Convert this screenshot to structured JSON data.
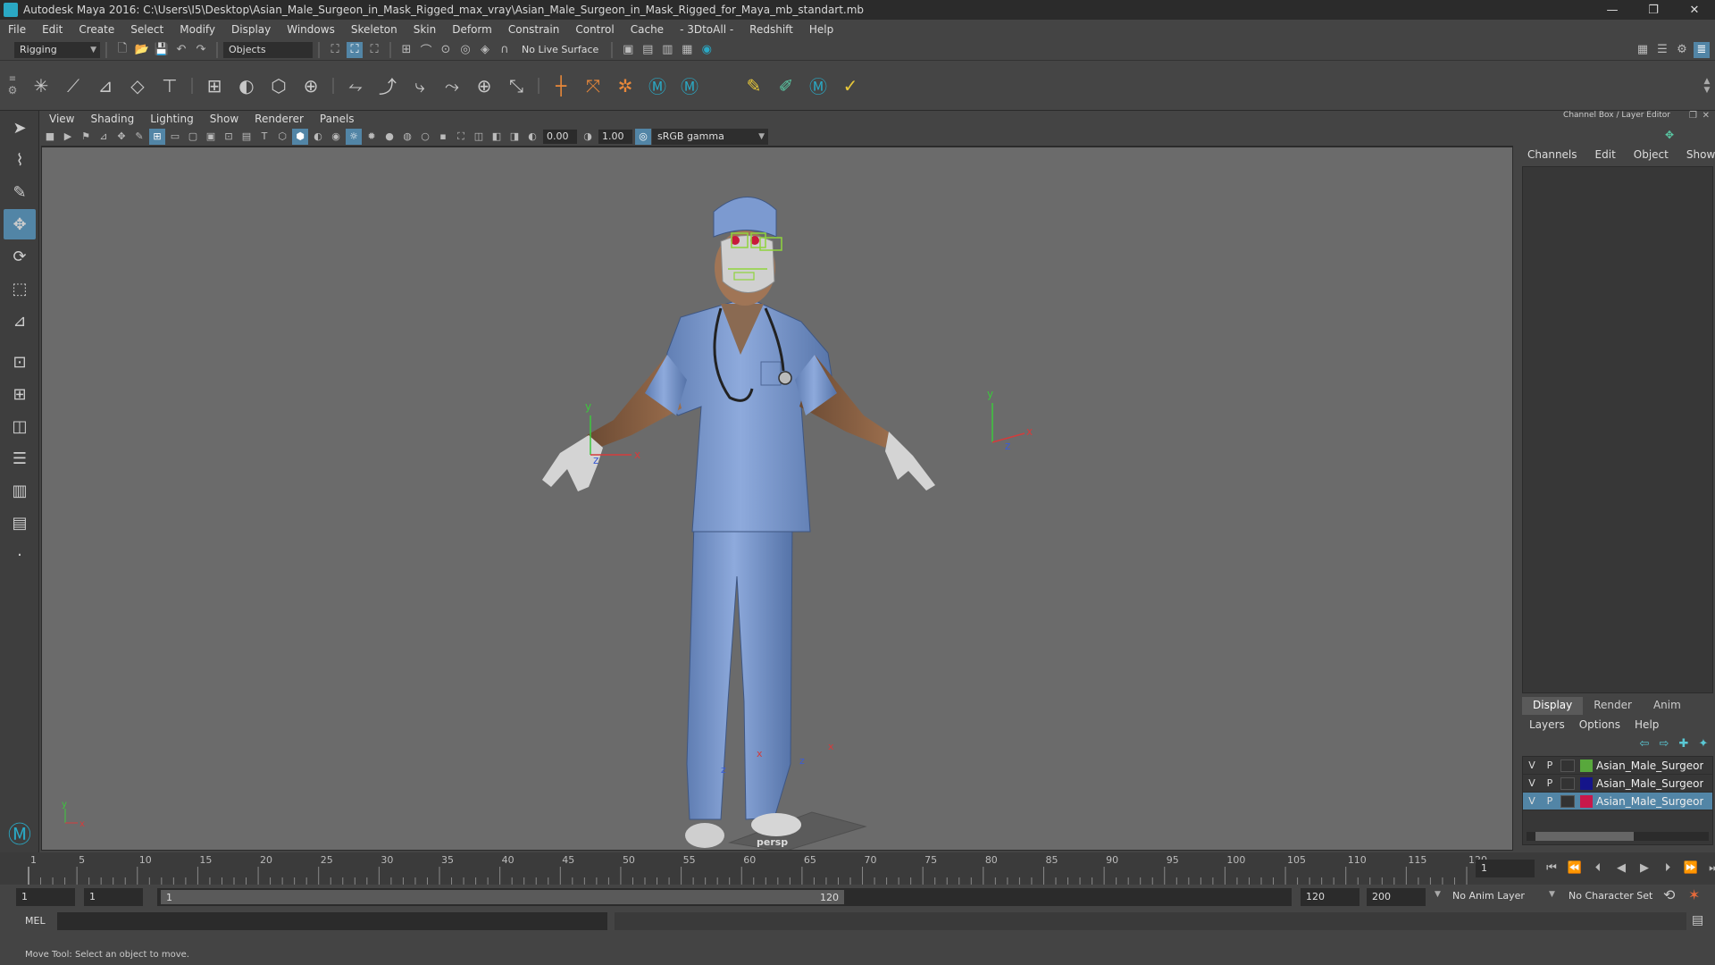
{
  "window": {
    "title": "Autodesk Maya 2016: C:\\Users\\I5\\Desktop\\Asian_Male_Surgeon_in_Mask_Rigged_max_vray\\Asian_Male_Surgeon_in_Mask_Rigged_for_Maya_mb_standart.mb",
    "minimize": "—",
    "restore": "❐",
    "close": "✕"
  },
  "menubar": [
    "File",
    "Edit",
    "Create",
    "Select",
    "Modify",
    "Display",
    "Windows",
    "Skeleton",
    "Skin",
    "Deform",
    "Constrain",
    "Control",
    "Cache",
    "- 3DtoAll -",
    "Redshift",
    "Help"
  ],
  "statusline": {
    "menuset": "Rigging",
    "selection_mode": "Objects",
    "live_surface": "No Live Surface"
  },
  "viewport": {
    "menu": [
      "View",
      "Shading",
      "Lighting",
      "Show",
      "Renderer",
      "Panels"
    ],
    "exposure": "0.00",
    "gamma": "1.00",
    "color_space": "sRGB gamma",
    "camera_label": "persp"
  },
  "channel_box": {
    "header": "Channel Box / Layer Editor",
    "menu": [
      "Channels",
      "Edit",
      "Object",
      "Show"
    ]
  },
  "layer_editor": {
    "tabs": [
      "Display",
      "Render",
      "Anim"
    ],
    "active_tab": "Display",
    "menu": [
      "Layers",
      "Options",
      "Help"
    ],
    "layers": [
      {
        "v": "V",
        "p": "P",
        "color": "#58a83c",
        "name": "Asian_Male_Surgeon_i",
        "selected": false
      },
      {
        "v": "V",
        "p": "P",
        "color": "#15158a",
        "name": "Asian_Male_Surgeon_i",
        "selected": false
      },
      {
        "v": "V",
        "p": "P",
        "color": "#c8184a",
        "name": "Asian_Male_Surgeon_i",
        "selected": true
      }
    ]
  },
  "timeline": {
    "ticks": [
      "1",
      "5",
      "10",
      "15",
      "20",
      "25",
      "30",
      "35",
      "40",
      "45",
      "50",
      "55",
      "60",
      "65",
      "70",
      "75",
      "80",
      "85",
      "90",
      "95",
      "100",
      "105",
      "110",
      "115",
      "120"
    ],
    "current_frame": "1"
  },
  "range": {
    "start": "1",
    "playback_start": "1",
    "slider_start": "1",
    "slider_end": "120",
    "playback_end": "120",
    "end": "200",
    "anim_layer": "No Anim Layer",
    "character_set": "No Character Set"
  },
  "command_line": {
    "lang": "MEL"
  },
  "help_line": "Move Tool: Select an object to move.",
  "colors": {
    "accent": "#5285a6",
    "scrubs": "#7e9ccc"
  }
}
